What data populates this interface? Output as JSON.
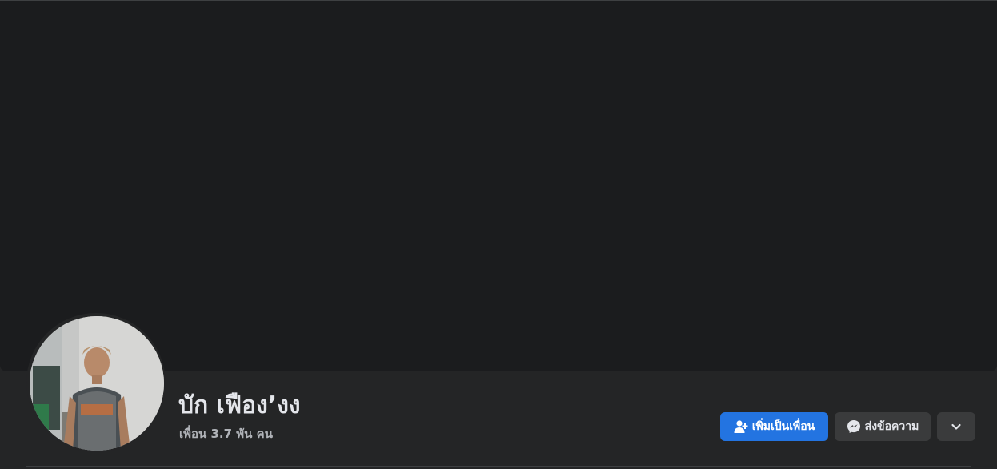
{
  "profile": {
    "name": "บัก เฟืองʼงง",
    "friends_count": "เพื่อน 3.7 พัน คน"
  },
  "actions": {
    "add_friend_label": "เพิ่มเป็นเพื่อน",
    "message_label": "ส่งข้อความ"
  },
  "icons": {
    "add_friend": "add-user-icon",
    "message": "messenger-icon",
    "more": "chevron-down-icon"
  },
  "colors": {
    "primary": "#2374e1",
    "secondary_button": "#3a3b3c",
    "background": "#242526",
    "cover": "#1b1c1e"
  }
}
